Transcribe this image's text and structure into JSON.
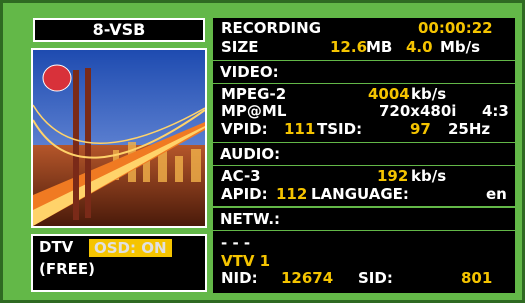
{
  "standard": "8-VSB",
  "recording": {
    "label": "RECORDING",
    "time": "00:00:22",
    "size_label": "SIZE",
    "size_value": "12.6",
    "size_unit": "MB",
    "rate_value": "4.0",
    "rate_unit": "Mb/s"
  },
  "video": {
    "header": "VIDEO:",
    "codec": "MPEG-2",
    "bitrate": "4004",
    "bitrate_unit": "kb/s",
    "profile": "MP@ML",
    "resolution": "720x480i",
    "aspect": "4:3",
    "vpid_label": "VPID:",
    "vpid": "111",
    "tsid_label": "TSID:",
    "tsid": "97",
    "framerate": "25Hz"
  },
  "audio": {
    "header": "AUDIO:",
    "codec": "AC-3",
    "bitrate": "192",
    "bitrate_unit": "kb/s",
    "apid_label": "APID:",
    "apid": "112",
    "language_label": "LANGUAGE:",
    "language": "en"
  },
  "network": {
    "header": "NETW.:",
    "name": "- - -",
    "service": "VTV 1",
    "nid_label": "NID:",
    "nid": "12674",
    "sid_label": "SID:",
    "sid": "801"
  },
  "mode": {
    "type": "DTV",
    "osd_label": "OSD: ON",
    "access": "(FREE)"
  },
  "colors": {
    "panel": "#000000",
    "background": "#63b848",
    "value": "#f5c400",
    "text": "#ffffff"
  }
}
